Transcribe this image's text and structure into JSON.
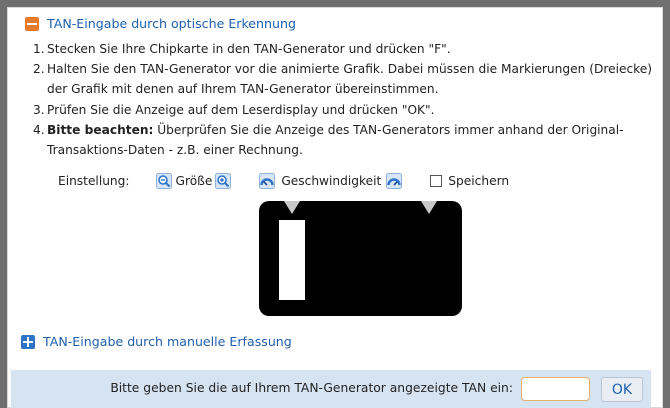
{
  "section_optical": {
    "title": "TAN-Eingabe durch optische Erkennung",
    "toggle_icon": "minus-icon",
    "steps": [
      {
        "num": "1.",
        "bold": "",
        "text": "Stecken Sie Ihre Chipkarte in den TAN-Generator und drücken \"F\"."
      },
      {
        "num": "2.",
        "bold": "",
        "text": "Halten Sie den TAN-Generator vor die animierte Grafik. Dabei müssen die Markierungen (Dreiecke) der Grafik mit denen auf Ihrem TAN-Generator übereinstimmen."
      },
      {
        "num": "3.",
        "bold": "",
        "text": "Prüfen Sie die Anzeige auf dem Leserdisplay und drücken \"OK\"."
      },
      {
        "num": "4.",
        "bold": "Bitte beachten:",
        "text": " Überprüfen Sie die Anzeige des TAN-Generators immer anhand der Original-Transaktions-Daten - z.B. einer Rechnung."
      }
    ],
    "settings": {
      "label": "Einstellung:",
      "size_label": "Größe",
      "speed_label": "Geschwindigkeit",
      "save_label": "Speichern",
      "save_checked": false
    }
  },
  "section_manual": {
    "title": "TAN-Eingabe durch manuelle Erfassung",
    "toggle_icon": "plus-icon"
  },
  "tan_entry": {
    "label": "Bitte geben Sie die auf Ihrem TAN-Generator angezeigte TAN ein:",
    "value": "",
    "ok_label": "OK"
  },
  "colors": {
    "link": "#1f5fae",
    "accent_orange": "#e87a2e",
    "accent_blue": "#2f73c8",
    "tan_bar_bg": "#d6e3f1"
  }
}
